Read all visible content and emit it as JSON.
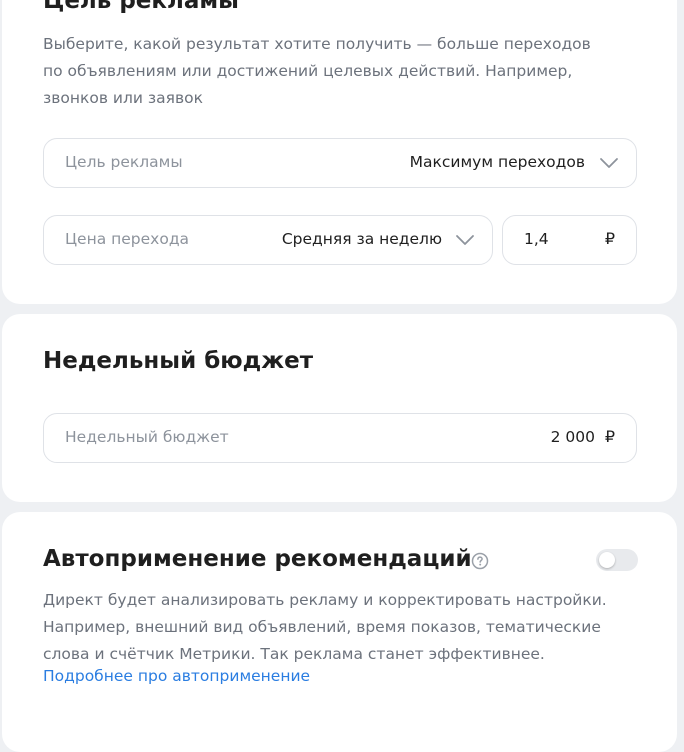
{
  "goal_section": {
    "title": "Цель рекламы",
    "description_lines": [
      "Выберите, какой результат хотите получить — больше переходов",
      "по объявлениям или достижений целевых действий. Например,",
      "звонков или заявок"
    ],
    "goal_field": {
      "label": "Цель рекламы",
      "value": "Максимум переходов"
    },
    "price_field": {
      "label": "Цена перехода",
      "value": "Средняя за неделю"
    },
    "price_amount": {
      "value": "1,4",
      "currency": "₽"
    }
  },
  "budget_section": {
    "title": "Недельный бюджет",
    "budget_field": {
      "label": "Недельный бюджет",
      "value": "2 000",
      "currency": "₽"
    }
  },
  "auto_section": {
    "title": "Автоприменение рекомендаций",
    "toggle_on": false,
    "description_lines": [
      "Директ будет анализировать рекламу и корректировать настройки.",
      "Например, внешний вид объявлений, время показов, тематические",
      "слова и счётчик Метрики. Так реклама станет эффективнее."
    ],
    "link_text": "Подробнее про автоприменение"
  },
  "colors": {
    "link": "#2a7de1",
    "muted_text": "#6c727c",
    "placeholder_text": "#8d939c",
    "border": "#dfe2e7",
    "page_background": "#eef0f3"
  },
  "icons": {
    "dropdown": "chevron-down-icon",
    "help": "question-circle-icon"
  }
}
